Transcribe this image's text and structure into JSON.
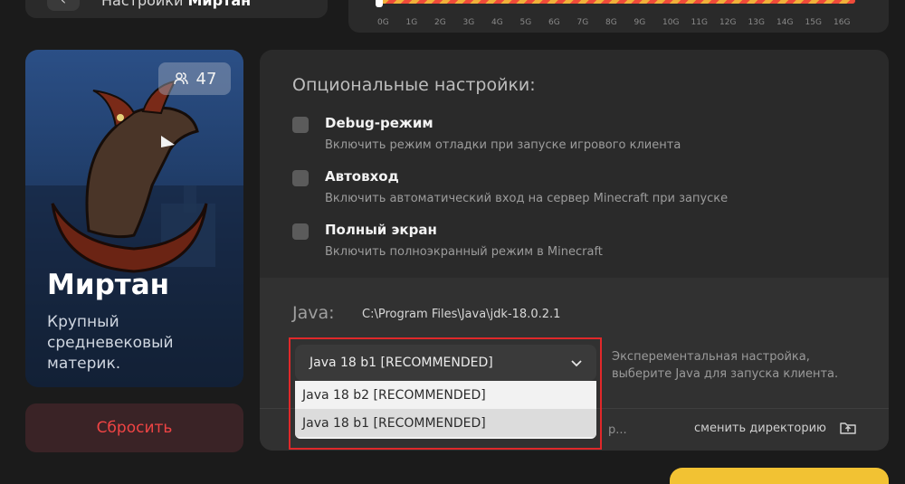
{
  "header": {
    "back_icon": "arrow-left-icon",
    "title_prefix": "Настройки",
    "title_server": "Миртан"
  },
  "ram": {
    "ticks": [
      "0G",
      "1G",
      "2G",
      "3G",
      "4G",
      "5G",
      "6G",
      "7G",
      "8G",
      "9G",
      "10G",
      "11G",
      "12G",
      "13G",
      "14G",
      "15G",
      "16G"
    ],
    "selected_fraction": 0
  },
  "server_card": {
    "online_icon": "users-icon",
    "online_count": "47",
    "name": "Миртан",
    "description": "Крупный средневековый материк."
  },
  "reset_button": "Сбросить",
  "optional": {
    "title": "Опциональные настройки:",
    "items": [
      {
        "label": "Debug-режим",
        "description": "Включить режим отладки при запуске игрового клиента",
        "checked": false
      },
      {
        "label": "Автовход",
        "description": "Включить автоматический вход на сервер Minecraft при запуске",
        "checked": false
      },
      {
        "label": "Полный экран",
        "description": "Включить полноэкранный режим в Minecraft",
        "checked": false
      }
    ]
  },
  "java": {
    "label": "Java:",
    "path": "C:\\Program Files\\Java\\jdk-18.0.2.1",
    "selected": "Java 18 b1 [RECOMMENDED]",
    "options": [
      "Java 18 b2 [RECOMMENDED]",
      "Java 18 b1 [RECOMMENDED]"
    ],
    "hint_line1": "Эксперементальная настройка,",
    "hint_line2": "выберите Java для запуска клиента.",
    "dir_partial": "р...",
    "change_dir": "сменить директорию",
    "folder_icon": "folder-upload-icon"
  },
  "colors": {
    "accent_red": "#e0282a",
    "reset_text": "#ef4444",
    "play_yellow": "#f2c233"
  }
}
